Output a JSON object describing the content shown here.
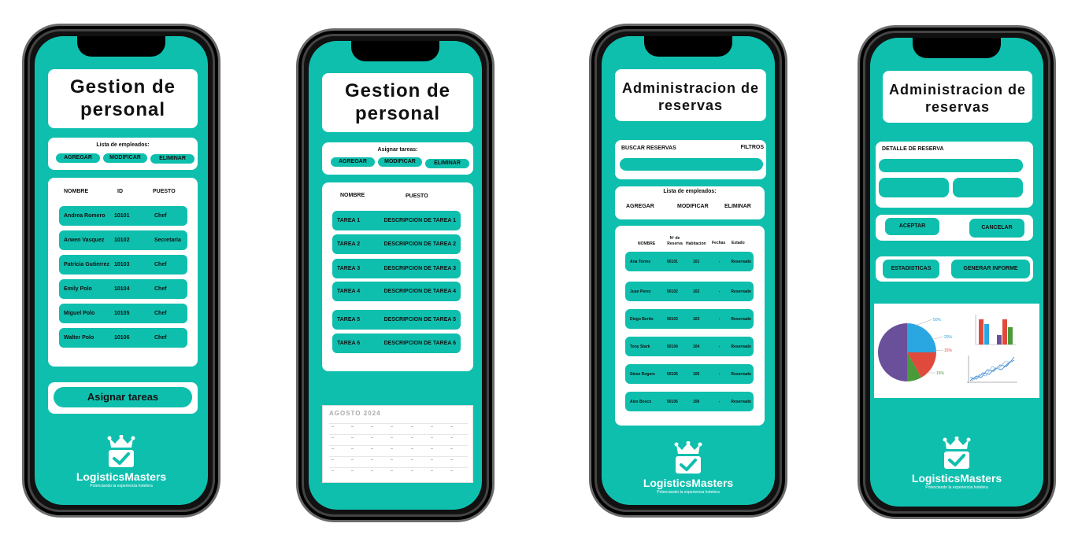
{
  "p1": {
    "title": "Gestion de personal",
    "list_title": "Lista de empleados:",
    "buttons": [
      "AGREGAR",
      "MODIFICAR",
      "ELIMINAR"
    ],
    "headers": [
      "NOMBRE",
      "ID",
      "PUESTO"
    ],
    "rows": [
      {
        "nombre": "Andrea Romero",
        "id": "10101",
        "puesto": "Chef"
      },
      {
        "nombre": "Arwen Vasquez",
        "id": "10102",
        "puesto": "Secretaria"
      },
      {
        "nombre": "Patricia Gutierrez",
        "id": "10103",
        "puesto": "Chef"
      },
      {
        "nombre": "Emily Polo",
        "id": "10104",
        "puesto": "Chef"
      },
      {
        "nombre": "Miguel Polo",
        "id": "10105",
        "puesto": "Chef"
      },
      {
        "nombre": "Walter Polo",
        "id": "10106",
        "puesto": "Chef"
      }
    ],
    "assign_button": "Asignar tareas"
  },
  "p2": {
    "title": "Gestion de personal",
    "assign_title": "Asignar tareas:",
    "buttons": [
      "AGREGAR",
      "MODIFICAR",
      "ELIMINAR"
    ],
    "headers": [
      "NOMBRE",
      "PUESTO"
    ],
    "rows": [
      {
        "tarea": "TAREA 1",
        "desc": "DESCRIPCION DE TAREA 1"
      },
      {
        "tarea": "TAREA 2",
        "desc": "DESCRIPCION DE TAREA 2"
      },
      {
        "tarea": "TAREA 3",
        "desc": "DESCRIPCION DE TAREA 3"
      },
      {
        "tarea": "TAREA 4",
        "desc": "DESCRIPCION DE TAREA 4"
      },
      {
        "tarea": "TAREA 5",
        "desc": "DESCRIPCION DE TAREA 5"
      },
      {
        "tarea": "TAREA 6",
        "desc": "DESCRIPCION DE TAREA 6"
      }
    ],
    "calendar_title": "AGOSTO 2024"
  },
  "p3": {
    "title": "Administracion de reservas",
    "search_label": "BUSCAR RESERVAS",
    "filters_label": "FILTROS",
    "list_title": "Lista de empleados:",
    "buttons": [
      "AGREGAR",
      "MODIFICAR",
      "ELIMINAR"
    ],
    "headers": [
      "NOMBRE",
      "Nº de Reserva",
      "Habitacion",
      "Fechas",
      "Estado"
    ],
    "rows": [
      {
        "nombre": "Ana Torres",
        "reserva": "50101",
        "hab": "101",
        "fechas": "-",
        "estado": "Reservado"
      },
      {
        "nombre": "Juan Perez",
        "reserva": "50102",
        "hab": "102",
        "fechas": "-",
        "estado": "Reservado"
      },
      {
        "nombre": "Diego Bertte",
        "reserva": "50103",
        "hab": "103",
        "fechas": "-",
        "estado": "Reservado"
      },
      {
        "nombre": "Tony Stark",
        "reserva": "50104",
        "hab": "104",
        "fechas": "-",
        "estado": "Reservado"
      },
      {
        "nombre": "Steve Rogers",
        "reserva": "50105",
        "hab": "105",
        "fechas": "-",
        "estado": "Reservado"
      },
      {
        "nombre": "Alex Bosco",
        "reserva": "50106",
        "hab": "106",
        "fechas": "-",
        "estado": "Reservado"
      }
    ]
  },
  "p4": {
    "title": "Administracion de reservas",
    "detail_label": "DETALLE DE RESERVA",
    "accept": "ACEPTAR",
    "cancel": "CANCELAR",
    "stats": "ESTADISTICAS",
    "report": "GENERAR INFORME",
    "pie_labels": [
      "50%",
      "20%",
      "15%",
      "15%"
    ]
  },
  "brand": {
    "name": "LogisticsMasters",
    "tagline": "Potenciando la experiencia hotelera"
  },
  "colors": {
    "accent": "#0fbfae",
    "frame": "#111111"
  }
}
